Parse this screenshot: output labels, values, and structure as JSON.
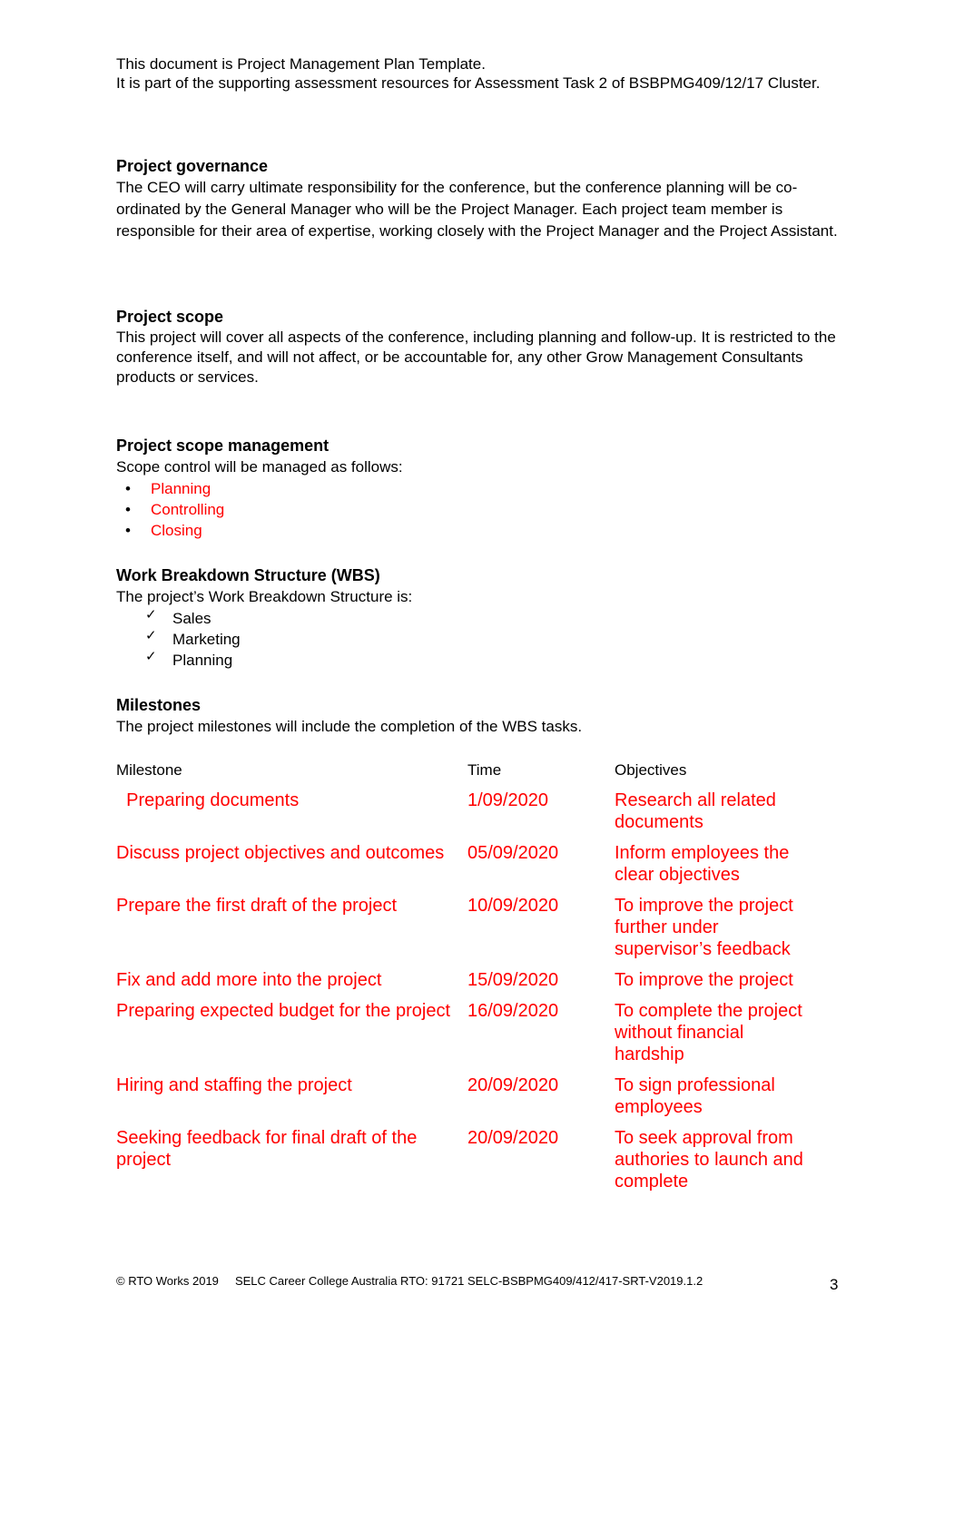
{
  "intro": {
    "line1": "This document is Project Management Plan Template.",
    "line2": "It is part of the supporting assessment resources for Assessment Task 2 of BSBPMG409/12/17 Cluster."
  },
  "governance": {
    "title": "Project governance",
    "body": "The CEO will carry ultimate responsibility for the conference, but the conference planning will be co-ordinated by the General Manager who will be the Project Manager. Each project team member is responsible for their area of expertise, working closely with the Project Manager and the Project Assistant."
  },
  "scope": {
    "title": "Project scope",
    "body": "This project will cover all aspects of the conference, including planning and follow-up. It is restricted to the conference itself, and will not affect, or be accountable for, any other Grow Management Consultants products or services."
  },
  "scope_management": {
    "title": "Project scope management",
    "intro": "Scope control will be managed as follows:",
    "items": [
      "Planning",
      "Controlling",
      "Closing"
    ],
    "bullet_icon": "•"
  },
  "wbs": {
    "title": "Work Breakdown Structure (WBS)",
    "intro": "The project’s Work Breakdown Structure is:",
    "items": [
      "Sales",
      "Marketing",
      "Planning"
    ],
    "check_icon": "✓"
  },
  "milestones": {
    "title": "Milestones",
    "intro": "The project milestones will include the completion of the WBS tasks.",
    "headers": [
      "Milestone",
      "Time",
      "Objectives"
    ],
    "rows": [
      {
        "milestone": "  Preparing documents",
        "time": "1/09/2020",
        "objective": "Research all related documents"
      },
      {
        "milestone": "Discuss project objectives and outcomes",
        "time": "05/09/2020",
        "objective": "Inform employees the clear objectives"
      },
      {
        "milestone": "Prepare the first draft of the project",
        "time": "10/09/2020",
        "objective": "To improve the project further under supervisor’s feedback"
      },
      {
        "milestone": "Fix and add more into the project",
        "time": "15/09/2020",
        "objective": "To improve the project"
      },
      {
        "milestone": "Preparing expected budget for the project",
        "time": "16/09/2020",
        "objective": "To complete the project without financial hardship"
      },
      {
        "milestone": "Hiring and staffing the project",
        "time": "20/09/2020",
        "objective": "To sign professional employees"
      },
      {
        "milestone": "Seeking feedback for final draft of the project",
        "time": "20/09/2020",
        "objective": "To seek approval from authories to launch and complete"
      }
    ]
  },
  "footer": {
    "text": "© RTO Works 2019     SELC Career College Australia RTO: 91721 SELC-BSBPMG409/412/417-SRT-V2019.1.2",
    "page_number": "3"
  },
  "colors": {
    "highlight": "#ff0000",
    "text": "#000000"
  }
}
